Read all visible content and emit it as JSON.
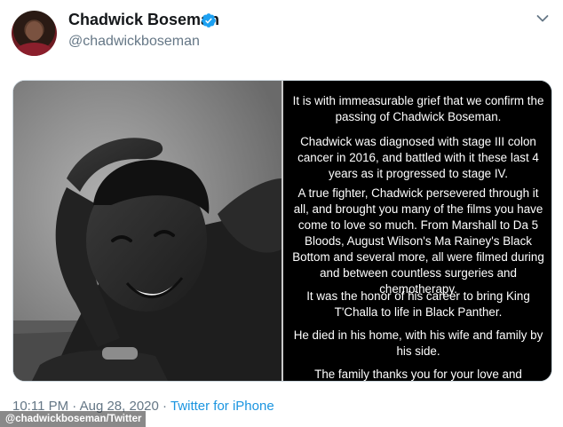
{
  "tweet": {
    "author_name": "Chadwick Boseman",
    "author_handle": "@chadwickboseman",
    "statement_paragraphs": [
      "It is with immeasurable grief that we confirm the passing of Chadwick Boseman.",
      "Chadwick was diagnosed with stage III colon cancer in 2016, and battled with it these last 4 years as it progressed to stage IV.",
      "A true fighter, Chadwick persevered through it all, and brought you many of the films you have come to love so much. From Marshall to Da 5 Bloods, August Wilson's Ma Rainey's Black Bottom and several more, all were filmed during and between countless surgeries and chemotherapy.",
      "It was the honor of his career to bring King T'Challa to life in Black Panther.",
      "He died in his home, with his wife and family by his side.",
      "The family thanks you for your love and"
    ],
    "time": "10:11 PM",
    "separator": "·",
    "date": "Aug 28, 2020",
    "source": "Twitter for iPhone"
  },
  "photo_credit": "@chadwickboseman/Twitter",
  "icons": {
    "verified": "verified-badge-icon",
    "menu": "chevron-down-icon"
  },
  "colors": {
    "verified_blue": "#1da1f2",
    "link_blue": "#1b95e0",
    "secondary_text": "#657786"
  }
}
